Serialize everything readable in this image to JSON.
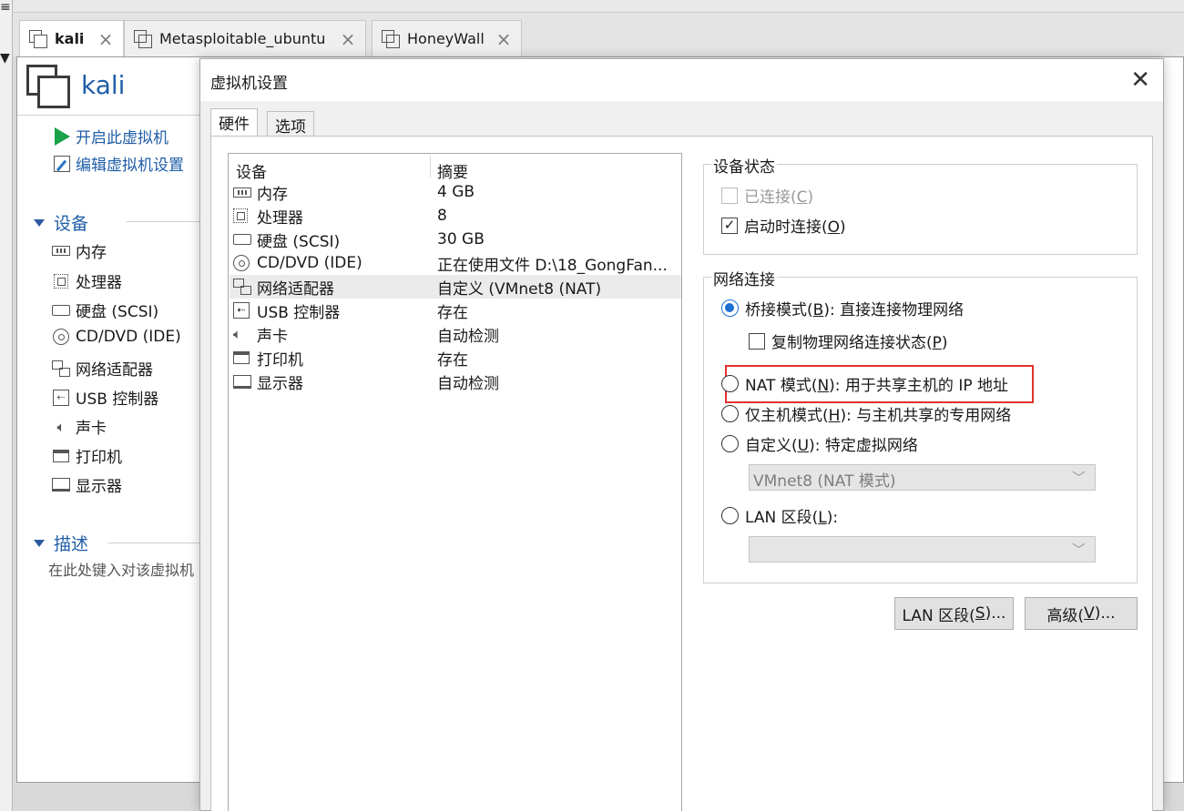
{
  "tabs": [
    {
      "label": "kali",
      "active": true
    },
    {
      "label": "Metasploitable_ubuntu",
      "active": false
    },
    {
      "label": "HoneyWall",
      "active": false
    }
  ],
  "vm": {
    "title": "kali",
    "actions": [
      "开启此虚拟机",
      "编辑虚拟机设置"
    ],
    "devices_section": "设备",
    "devices": [
      "内存",
      "处理器",
      "硬盘 (SCSI)",
      "CD/DVD (IDE)",
      "网络适配器",
      "USB 控制器",
      "声卡",
      "打印机",
      "显示器"
    ],
    "desc_section": "描述",
    "desc_placeholder": "在此处键入对该虚拟机"
  },
  "dialog": {
    "title": "虚拟机设置",
    "tabs": [
      "硬件",
      "选项"
    ],
    "device_table": {
      "headers": [
        "设备",
        "摘要"
      ],
      "rows": [
        {
          "name": "内存",
          "summary": "4 GB"
        },
        {
          "name": "处理器",
          "summary": "8"
        },
        {
          "name": "硬盘 (SCSI)",
          "summary": "30 GB"
        },
        {
          "name": "CD/DVD (IDE)",
          "summary": "正在使用文件 D:\\18_GongFan..."
        },
        {
          "name": "网络适配器",
          "summary": "自定义 (VMnet8 (NAT)",
          "selected": true
        },
        {
          "name": "USB 控制器",
          "summary": "存在"
        },
        {
          "name": "声卡",
          "summary": "自动检测"
        },
        {
          "name": "打印机",
          "summary": "存在"
        },
        {
          "name": "显示器",
          "summary": "自动检测"
        }
      ]
    },
    "device_status": {
      "title": "设备状态",
      "connected": {
        "prefix": "已连接(",
        "key": "C",
        "suffix": ")",
        "checked": false,
        "disabled": true
      },
      "connect_at_power_on": {
        "prefix": "启动时连接(",
        "key": "O",
        "suffix": ")",
        "checked": true
      }
    },
    "network": {
      "title": "网络连接",
      "bridged": {
        "prefix": "桥接模式(",
        "key": "B",
        "suffix": "): 直接连接物理网络",
        "checked": true
      },
      "replicate": {
        "prefix": "复制物理网络连接状态(",
        "key": "P",
        "suffix": ")",
        "checked": false
      },
      "nat": {
        "prefix": "NAT 模式(",
        "key": "N",
        "suffix": "): 用于共享主机的 IP 地址"
      },
      "host_only": {
        "prefix": "仅主机模式(",
        "key": "H",
        "suffix": "): 与主机共享的专用网络"
      },
      "custom": {
        "prefix": "自定义(",
        "key": "U",
        "suffix": "): 特定虚拟网络"
      },
      "custom_select": "VMnet8 (NAT 模式)",
      "lan": {
        "prefix": "LAN 区段(",
        "key": "L",
        "suffix": "):"
      },
      "lan_select": ""
    },
    "buttons": {
      "lan_segments": {
        "prefix": "LAN 区段(",
        "key": "S",
        "suffix": ")..."
      },
      "advanced": {
        "prefix": "高级(",
        "key": "V",
        "suffix": ")..."
      }
    },
    "accent_color": "#1d6fd1",
    "highlight_color": "#e0312d"
  }
}
